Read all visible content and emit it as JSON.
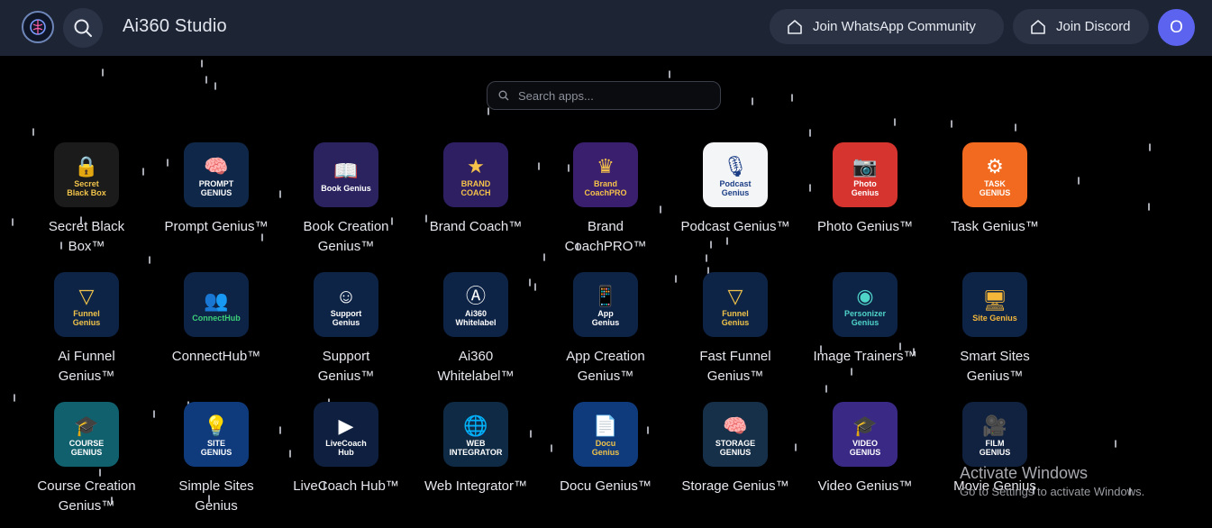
{
  "header": {
    "title": "Ai360 Studio",
    "logo_icon": "brain-logo-icon",
    "whatsapp_label": "Join WhatsApp Community",
    "discord_label": "Join Discord",
    "avatar_initial": "O"
  },
  "search": {
    "placeholder": "Search apps..."
  },
  "apps": [
    {
      "name": "Secret Black\nBox™",
      "tile": "Secret\nBlack Box",
      "glyph": "🔒",
      "bg": "#1b1b1b",
      "fg": "#f0c34a"
    },
    {
      "name": "Prompt Genius™",
      "tile": "PROMPT\nGENIUS",
      "glyph": "🧠",
      "bg": "#0f2748",
      "fg": "#ffffff"
    },
    {
      "name": "Book Creation\nGenius™",
      "tile": "Book Genius",
      "glyph": "📖",
      "bg": "#2a2360",
      "fg": "#ffffff"
    },
    {
      "name": "Brand Coach™",
      "tile": "BRAND\nCOACH",
      "glyph": "★",
      "bg": "#2e1f63",
      "fg": "#f5c24a"
    },
    {
      "name": "Brand\nCoachPRO™",
      "tile": "Brand\nCoachPRO",
      "glyph": "♛",
      "bg": "#3a1f6e",
      "fg": "#f5c24a"
    },
    {
      "name": "Podcast Genius™",
      "tile": "Podcast\nGenius",
      "glyph": "🎙",
      "bg": "#f4f5f7",
      "fg": "#1b3d85"
    },
    {
      "name": "Photo Genius™",
      "tile": "Photo\nGenius",
      "glyph": "📷",
      "bg": "#d6342f",
      "fg": "#ffffff"
    },
    {
      "name": "Task Genius™",
      "tile": "TASK\nGENIUS",
      "glyph": "⚙",
      "bg": "#f26a1f",
      "fg": "#ffffff"
    },
    {
      "name": "Ai Funnel\nGenius™",
      "tile": "Funnel\nGenius",
      "glyph": "▽",
      "bg": "#0e2446",
      "fg": "#f0c34a"
    },
    {
      "name": "ConnectHub™",
      "tile": "ConnectHub",
      "glyph": "👥",
      "bg": "#0e2446",
      "fg": "#3ccf7a"
    },
    {
      "name": "Support\nGenius™",
      "tile": "Support\nGenius",
      "glyph": "☺",
      "bg": "#0e2446",
      "fg": "#ffffff"
    },
    {
      "name": "Ai360\nWhitelabel™",
      "tile": "Ai360\nWhitelabel",
      "glyph": "Ⓐ",
      "bg": "#0e2446",
      "fg": "#ffffff"
    },
    {
      "name": "App Creation\nGenius™",
      "tile": "App\nGenius",
      "glyph": "📱",
      "bg": "#0e2446",
      "fg": "#ffffff"
    },
    {
      "name": "Fast Funnel\nGenius™",
      "tile": "Funnel\nGenius",
      "glyph": "▽",
      "bg": "#0e2446",
      "fg": "#f0c34a"
    },
    {
      "name": "Image Trainers™",
      "tile": "Personizer\nGenius",
      "glyph": "◉",
      "bg": "#0e2446",
      "fg": "#4fd4c8"
    },
    {
      "name": "Smart Sites\nGenius™",
      "tile": "Site Genius",
      "glyph": "🖥",
      "bg": "#0e2446",
      "fg": "#f5b73a"
    },
    {
      "name": "Course Creation\nGenius™",
      "tile": "COURSE\nGENIUS",
      "glyph": "🎓",
      "bg": "#10606e",
      "fg": "#ffffff"
    },
    {
      "name": "Simple Sites\nGenius",
      "tile": "SITE\nGENIUS",
      "glyph": "💡",
      "bg": "#0f3b7d",
      "fg": "#ffffff"
    },
    {
      "name": "LiveCoach Hub™",
      "tile": "LiveCoach\nHub",
      "glyph": "▶",
      "bg": "#0e1f3f",
      "fg": "#ffffff"
    },
    {
      "name": "Web Integrator™",
      "tile": "WEB\nINTEGRATOR",
      "glyph": "🌐",
      "bg": "#0f2a44",
      "fg": "#ffffff"
    },
    {
      "name": "Docu Genius™",
      "tile": "Docu\nGenius",
      "glyph": "📄",
      "bg": "#0f3b7d",
      "fg": "#f0c34a"
    },
    {
      "name": "Storage Genius™",
      "tile": "STORAGE\nGENIUS",
      "glyph": "🧠",
      "bg": "#163049",
      "fg": "#ffffff"
    },
    {
      "name": "Video Genius™",
      "tile": "VIDEO\nGENIUS",
      "glyph": "🎓",
      "bg": "#3a2a86",
      "fg": "#ffffff"
    },
    {
      "name": "Movie Genius",
      "tile": "FILM\nGENIUS",
      "glyph": "🎥",
      "bg": "#10223f",
      "fg": "#ffffff"
    }
  ],
  "watermark": {
    "line1": "Activate Windows",
    "line2": "Go to Settings to activate Windows."
  }
}
